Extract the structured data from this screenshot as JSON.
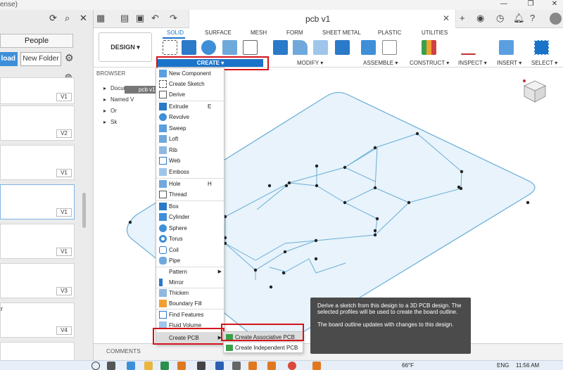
{
  "window": {
    "license_fragment": "ense)",
    "doc_title": "pcb v1"
  },
  "left_panel": {
    "people_tab": "People",
    "upload_label": "load",
    "new_folder_label": "New Folder",
    "cards": [
      {
        "version": "V1"
      },
      {
        "version": "V2"
      },
      {
        "version": "V1"
      },
      {
        "version": "V1"
      },
      {
        "version": "V1"
      },
      {
        "version": "V3"
      },
      {
        "version": "V4",
        "letter": "r"
      },
      {
        "version": ""
      }
    ]
  },
  "ribbon": {
    "workspace": "DESIGN ▾",
    "tabs": [
      "SOLID",
      "SURFACE",
      "MESH",
      "FORM",
      "SHEET METAL",
      "PLASTIC",
      "UTILITIES"
    ],
    "groups": {
      "create": "CREATE ▾",
      "modify": "MODIFY ▾",
      "assemble": "ASSEMBLE ▾",
      "construct": "CONSTRUCT ▾",
      "inspect": "INSPECT ▾",
      "insert": "INSERT ▾",
      "select": "SELECT ▾"
    }
  },
  "browser": {
    "header": "BROWSER",
    "root": "pcb v1",
    "items": [
      "Docume",
      "Named V",
      "Or",
      "Sk"
    ]
  },
  "create_menu": {
    "items": [
      {
        "label": "New Component",
        "shortcut": ""
      },
      {
        "label": "Create Sketch",
        "shortcut": ""
      },
      {
        "label": "Derive",
        "shortcut": ""
      },
      {
        "label": "Extrude",
        "shortcut": "E"
      },
      {
        "label": "Revolve",
        "shortcut": ""
      },
      {
        "label": "Sweep",
        "shortcut": ""
      },
      {
        "label": "Loft",
        "shortcut": ""
      },
      {
        "label": "Rib",
        "shortcut": ""
      },
      {
        "label": "Web",
        "shortcut": ""
      },
      {
        "label": "Emboss",
        "shortcut": ""
      },
      {
        "label": "Hole",
        "shortcut": "H"
      },
      {
        "label": "Thread",
        "shortcut": ""
      },
      {
        "label": "Box",
        "shortcut": ""
      },
      {
        "label": "Cylinder",
        "shortcut": ""
      },
      {
        "label": "Sphere",
        "shortcut": ""
      },
      {
        "label": "Torus",
        "shortcut": ""
      },
      {
        "label": "Coil",
        "shortcut": ""
      },
      {
        "label": "Pipe",
        "shortcut": ""
      },
      {
        "label": "Pattern",
        "shortcut": ""
      },
      {
        "label": "Mirror",
        "shortcut": ""
      },
      {
        "label": "Thicken",
        "shortcut": ""
      },
      {
        "label": "Boundary Fill",
        "shortcut": ""
      },
      {
        "label": "Find Features",
        "shortcut": ""
      },
      {
        "label": "Fluid Volume",
        "shortcut": ""
      },
      {
        "label": "Create PCB",
        "shortcut": ""
      }
    ]
  },
  "pcb_submenu": {
    "associative": "Create Associative PCB",
    "independent": "Create Independent PCB"
  },
  "tooltip": {
    "line1": "Derive a sketch from this design to a 3D PCB design. The selected profiles will be used to create the board outline.",
    "line2": "The board outline updates with changes to this design."
  },
  "comments": {
    "label": "COMMENTS"
  },
  "taskbar": {
    "temperature": "66°F",
    "language": "ENG",
    "time": "11:56 AM"
  },
  "colors": {
    "accent": "#1a73c9",
    "highlight_box": "#d3141b",
    "sketch_fill": "#e8f3fb",
    "sketch_line": "#6aaed6"
  }
}
